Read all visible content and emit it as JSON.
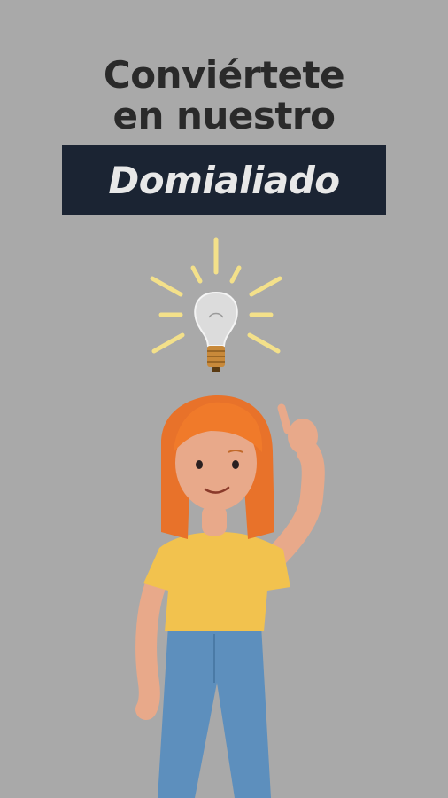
{
  "headline": {
    "line1": "Conviértete",
    "line2": "en nuestro",
    "highlight": "Domialiado"
  },
  "colors": {
    "background": "#a9a9a9",
    "banner": "#1b2433",
    "headline_text": "#2a2a2a",
    "highlight_text": "#e8e8e8",
    "rays": "#f3e08a",
    "hair": "#f07a2a",
    "shirt": "#f2c24e",
    "jeans": "#5d8fbd"
  },
  "icons": [
    "lightbulb-icon",
    "woman-illustration"
  ]
}
